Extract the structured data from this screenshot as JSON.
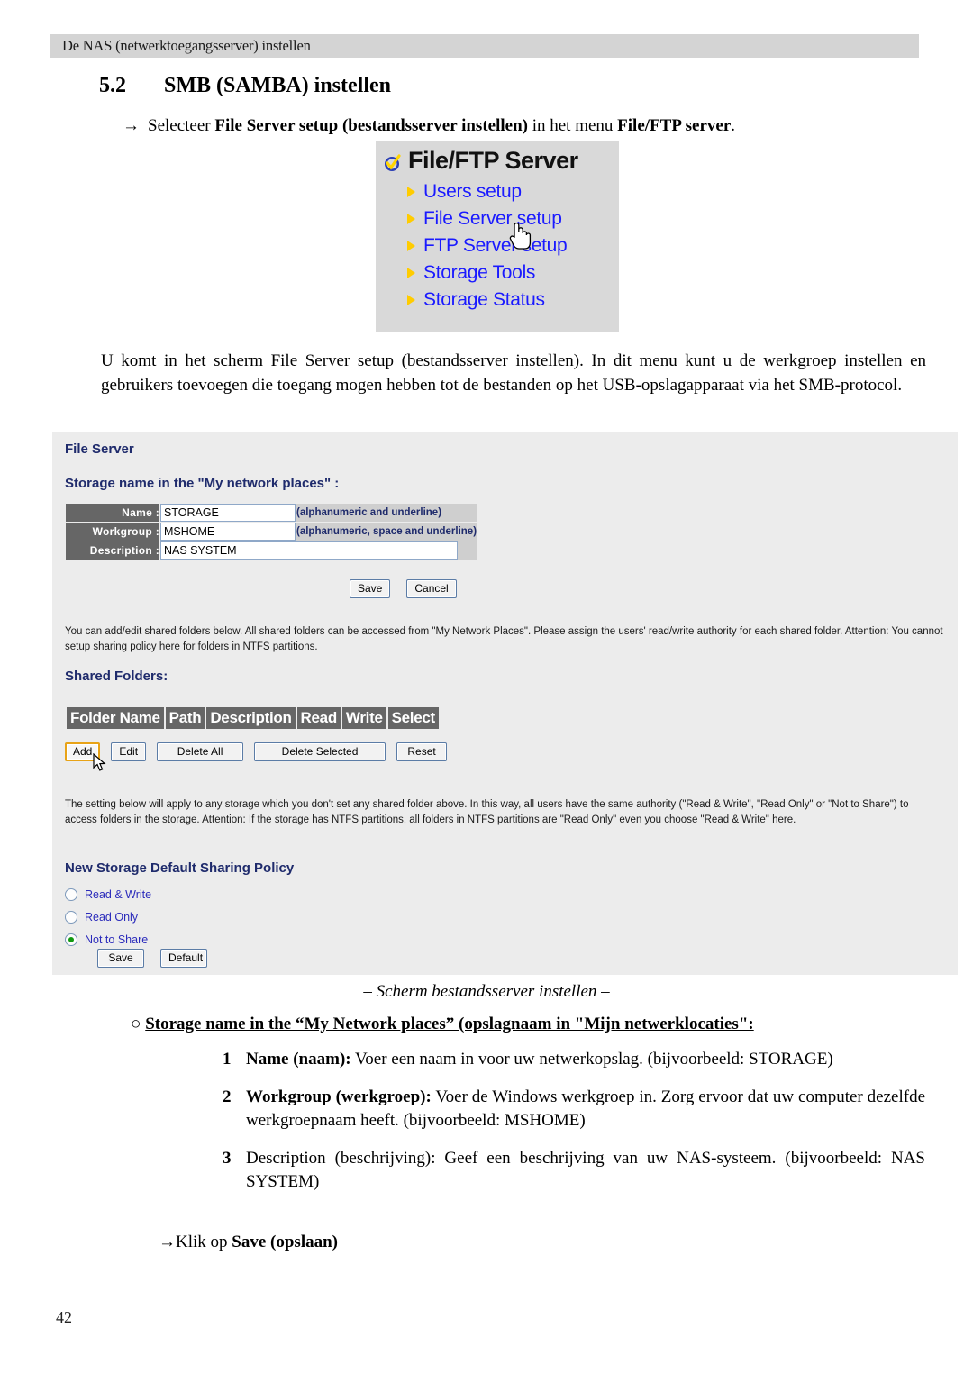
{
  "running_header": "De NAS (netwerktoegangsserver) instellen",
  "section": {
    "number": "5.2",
    "title": "SMB (SAMBA) instellen"
  },
  "intro": {
    "arrow": "→",
    "part1": "Selecteer ",
    "bold1": "File Server setup (bestandsserver instellen)",
    "part2": " in het menu ",
    "bold2": "File/FTP server",
    "part3": "."
  },
  "ftp_menu": {
    "title": "File/FTP Server",
    "items": [
      {
        "label": "Users setup"
      },
      {
        "label": "File Server setup"
      },
      {
        "label": "FTP Server setup"
      },
      {
        "label": "Storage Tools"
      },
      {
        "label": "Storage Status"
      }
    ]
  },
  "body_paragraph": "U komt in het scherm File Server setup (bestandsserver instellen). In dit menu kunt u de werkgroep instellen en gebruikers toevoegen die toegang mogen hebben tot de bestanden op het USB-opslagapparaat via het SMB-protocol.",
  "webui": {
    "title": "File Server",
    "storage_name_heading": "Storage name in the \"My network places\"  :",
    "fields": [
      {
        "label": "Name :",
        "value": "STORAGE",
        "hint": "(alphanumeric and underline)"
      },
      {
        "label": "Workgroup :",
        "value": "MSHOME",
        "hint": "(alphanumeric, space and underline)"
      },
      {
        "label": "Description :",
        "value": "NAS SYSTEM",
        "hint": ""
      }
    ],
    "save_label": "Save",
    "cancel_label": "Cancel",
    "note_shared": "You can add/edit shared folders below. All shared folders can be accessed from \"My Network Places\". Please assign the users' read/write authority for each shared folder. Attention: You cannot setup sharing policy here for folders in NTFS partitions.",
    "shared_folders_heading": "Shared Folders:",
    "table_headers": [
      "Folder Name",
      "Path",
      "Description",
      "Read",
      "Write",
      "Select"
    ],
    "folder_buttons": [
      {
        "label": "Add"
      },
      {
        "label": "Edit"
      },
      {
        "label": "Delete All"
      },
      {
        "label": "Delete Selected"
      },
      {
        "label": "Reset"
      }
    ],
    "note_policy": "The setting below will apply to any storage which you don't set any shared folder above. In this way, all users have the same authority (\"Read & Write\", \"Read Only\" or \"Not to Share\") to access folders in the storage. Attention: If the storage has NTFS partitions, all folders in NTFS partitions are \"Read Only\" even you choose \"Read & Write\" here.",
    "policy_heading": "New Storage Default Sharing Policy",
    "policy_options": [
      {
        "label": "Read & Write",
        "selected": false
      },
      {
        "label": "Read Only",
        "selected": false
      },
      {
        "label": "Not to Share",
        "selected": true
      }
    ],
    "policy_save_label": "Save",
    "policy_default_label": "Default",
    "colors": {
      "panel_bg": "#ececec",
      "heading": "#1f2b6c",
      "label_bg": "#666666",
      "link_blue": "#1a1aff",
      "radio_on": "#119911",
      "focus_border": "#e8a317"
    }
  },
  "caption": "– Scherm bestandsserver instellen –",
  "storage_heading": {
    "bullet": "○",
    "text": "Storage name in the “My Network places” (opslagnaam in \"Mijn netwerklocaties\":"
  },
  "numbered_items": [
    {
      "num": "1",
      "bold": "Name (naam):",
      "rest": " Voer een naam in voor uw netwerkopslag. (bijvoorbeeld: STORAGE)"
    },
    {
      "num": "2",
      "bold": "Workgroup (werkgroep):",
      "rest": " Voer de Windows werkgroep in. Zorg ervoor dat uw computer dezelfde werkgroepnaam heeft. (bijvoorbeeld: MSHOME)"
    },
    {
      "num": "3",
      "bold": "",
      "rest": "Description (beschrijving): Geef een beschrijving van uw NAS-systeem. (bijvoorbeeld: NAS SYSTEM)"
    }
  ],
  "klik_line": {
    "arrow": "→",
    "prefix": "Klik op ",
    "bold": "Save (opslaan)"
  },
  "page_number": "42"
}
